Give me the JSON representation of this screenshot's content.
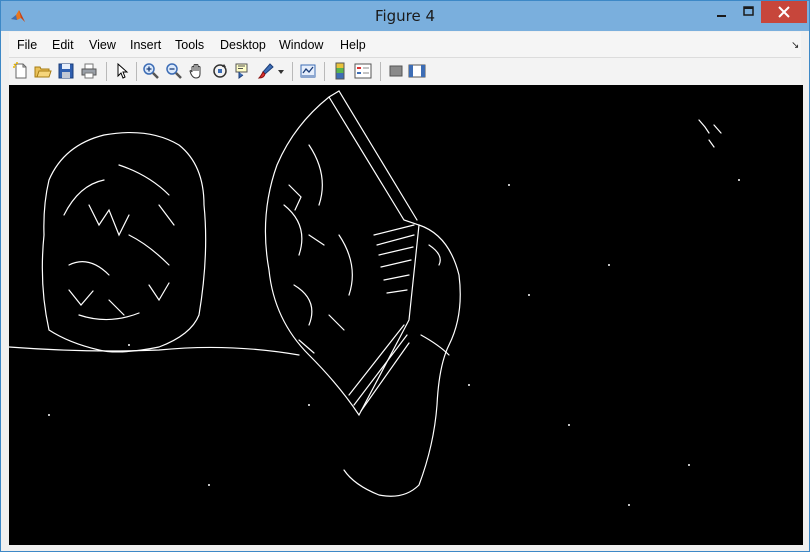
{
  "window": {
    "title": "Figure 4",
    "buttons": {
      "minimize_icon": "minimize-icon",
      "maximize_icon": "maximize-icon",
      "close_icon": "close-icon"
    }
  },
  "menubar": {
    "items": [
      "File",
      "Edit",
      "View",
      "Insert",
      "Tools",
      "Desktop",
      "Window",
      "Help"
    ]
  },
  "toolbar": {
    "icons": [
      "new-figure-icon",
      "open-file-icon",
      "save-icon",
      "print-icon",
      "edit-plot-arrow-icon",
      "zoom-in-icon",
      "zoom-out-icon",
      "pan-hand-icon",
      "rotate-3d-icon",
      "data-cursor-icon",
      "brush-icon",
      "brush-dropdown-icon",
      "link-plot-icon",
      "colorbar-icon",
      "legend-icon",
      "hide-plot-tools-icon",
      "show-plot-tools-icon"
    ]
  },
  "figure": {
    "content": "edge-detection-image",
    "background": "#000000",
    "foreground": "#ffffff"
  }
}
